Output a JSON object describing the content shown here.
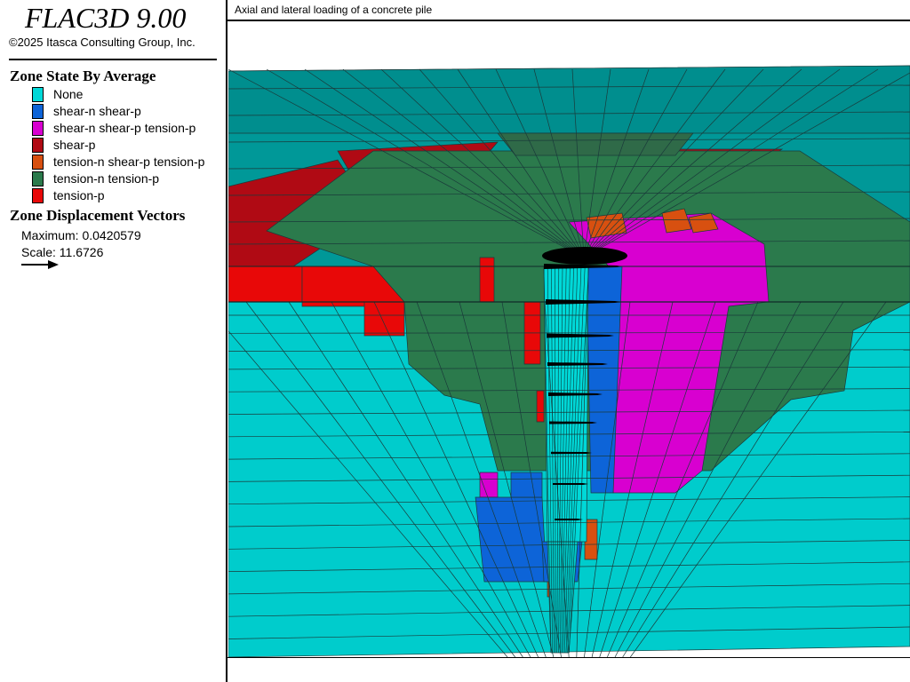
{
  "app": {
    "title": "FLAC3D 9.00",
    "copyright": "©2025 Itasca Consulting Group, Inc."
  },
  "plot": {
    "title": "Axial and lateral loading of a concrete pile"
  },
  "legend": {
    "zone_state_title": "Zone State By Average",
    "items": [
      {
        "label": "None",
        "color": "#00d8d8"
      },
      {
        "label": "shear-n shear-p",
        "color": "#0d64d8"
      },
      {
        "label": "shear-n shear-p tension-p",
        "color": "#d800d0"
      },
      {
        "label": "shear-p",
        "color": "#b00a14"
      },
      {
        "label": "tension-n shear-p tension-p",
        "color": "#d85010"
      },
      {
        "label": "tension-n tension-p",
        "color": "#2b7a4c"
      },
      {
        "label": "tension-p",
        "color": "#e80808"
      }
    ],
    "displacement_title": "Zone Displacement Vectors",
    "maximum_text": "Maximum: 0.0420579",
    "scale_text": "Scale: 11.6726",
    "arrow_icon": "arrow-right-icon"
  },
  "colors": {
    "ground_top": "#009898",
    "ground_side": "#00cccc",
    "mesh_line": "#1a3a3a"
  }
}
